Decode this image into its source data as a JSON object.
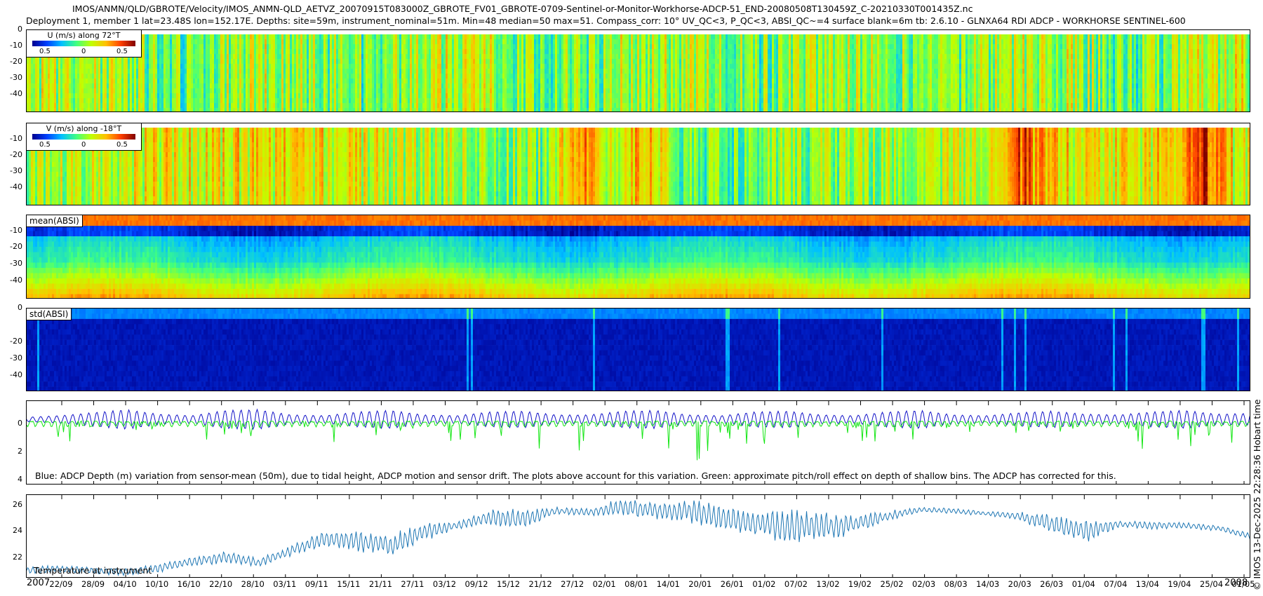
{
  "header": {
    "line1": "IMOS/ANMN/QLD/GBROTE/Velocity/IMOS_ANMN-QLD_AETVZ_20070915T083000Z_GBROTE_FV01_GBROTE-0709-Sentinel-or-Monitor-Workhorse-ADCP-51_END-20080508T130459Z_C-20210330T001435Z.nc",
    "line2": "Deployment 1, member 1 lat=23.48S lon=152.17E. Depths: site=59m, instrument_nominal=51m. Min=48 median=50 max=51. Compass_corr: 10° UV_QC<3, P_QC<3, ABSI_QC~=4 surface blank=6m tb: 2.6.10 - GLNXA64 RDI ADCP - WORKHORSE SENTINEL-600"
  },
  "right_label": "© IMOS 13-Dec-2025 22:28:36 Hobart time",
  "colors": {
    "blue_series": "#1414c8",
    "green_series": "#14e614",
    "temp_series": "#1f77b4",
    "jet": [
      "#00008f",
      "#0040ff",
      "#00c0ff",
      "#40ff80",
      "#c0ff00",
      "#ffc000",
      "#ff4000",
      "#800000"
    ]
  },
  "panels": {
    "u": {
      "colorbar_title": "U (m/s) along 72°T",
      "colorbar_ticks": [
        "0.5",
        "0",
        "0.5"
      ],
      "ylabels": [
        "0",
        "-10",
        "-20",
        "-30",
        "-40"
      ]
    },
    "v": {
      "colorbar_title": "V (m/s) along -18°T",
      "colorbar_ticks": [
        "0.5",
        "0",
        "0.5"
      ],
      "ylabels": [
        "0",
        "-10",
        "-20",
        "-30",
        "-40"
      ]
    },
    "mean": {
      "tag": "mean(ABSI)",
      "ylabels": [
        "0",
        "-10",
        "-20",
        "-30",
        "-40"
      ]
    },
    "std": {
      "tag": "std(ABSI)",
      "ylabels": [
        "0",
        "-10",
        "-20",
        "-30",
        "-40"
      ]
    },
    "depth": {
      "note": "Blue: ADCP Depth (m) variation from sensor-mean (50m), due to tidal height, ADCP motion and sensor drift. The plots above account for this variation. Green: approximate pitch/roll effect on depth of shallow bins. The ADCP has corrected for this.",
      "ylabels": [
        "0",
        "2",
        "4"
      ]
    },
    "temp": {
      "note": "Temperature at instrument",
      "ylabels": [
        "26",
        "24",
        "22"
      ]
    }
  },
  "chart_data": [
    {
      "type": "heatmap",
      "name": "U (m/s) along 72°T",
      "x_range": [
        "2007-09-15",
        "2008-05-08"
      ],
      "y_range_m": [
        -50,
        0
      ],
      "color_range": [
        -0.5,
        0.5
      ],
      "description": "Horizontal velocity component, mostly near 0 with alternating tidal bands"
    },
    {
      "type": "heatmap",
      "name": "V (m/s) along -18°T",
      "x_range": [
        "2007-09-15",
        "2008-05-08"
      ],
      "y_range_m": [
        -50,
        0
      ],
      "color_range": [
        -0.5,
        0.5
      ],
      "high_events": [
        {
          "date": "2007-12-31",
          "value": 0.5
        },
        {
          "date": "2008-01-12",
          "value": 0.4
        },
        {
          "date": "2008-03-24",
          "value": 0.3
        },
        {
          "date": "2008-04-28",
          "value": 0.45
        }
      ]
    },
    {
      "type": "heatmap",
      "name": "mean(ABSI)",
      "x_range": [
        "2007-09-15",
        "2008-05-08"
      ],
      "y_range_m": [
        -50,
        0
      ]
    },
    {
      "type": "heatmap",
      "name": "std(ABSI)",
      "x_range": [
        "2007-09-15",
        "2008-05-08"
      ],
      "y_range_m": [
        -50,
        0
      ]
    },
    {
      "type": "line",
      "name": "ADCP depth variation",
      "ylim": [
        4.2,
        -1.3
      ],
      "x_ticks": [
        "22/09",
        "28/09",
        "04/10",
        "10/10",
        "16/10",
        "22/10",
        "28/10",
        "03/11",
        "09/11",
        "15/11",
        "21/11",
        "27/11",
        "03/12",
        "09/12",
        "15/12",
        "21/12",
        "27/12",
        "02/01",
        "08/01",
        "14/01",
        "20/01",
        "26/01",
        "01/02",
        "07/02",
        "13/02",
        "19/02",
        "25/02",
        "02/03",
        "08/03",
        "14/03",
        "20/03",
        "26/03",
        "01/04",
        "07/04",
        "13/04",
        "19/04",
        "25/04",
        "01/05"
      ],
      "blue_amplitude_m": [
        0.3,
        0.5,
        0.9,
        1.3,
        0.7,
        0.5,
        1.2,
        1.3,
        0.6,
        0.5,
        1.0,
        1.2,
        0.6,
        0.5,
        1.0,
        1.1,
        0.6,
        0.6,
        1.1,
        1.2,
        0.6,
        0.5,
        1.0,
        1.1,
        0.6,
        0.5,
        1.0,
        1.2,
        0.6,
        0.5,
        0.9,
        1.1,
        0.7,
        0.6,
        1.0,
        1.2,
        0.7,
        0.8
      ],
      "green_min_m": [
        0.5,
        0.9,
        2.3,
        1.0,
        0.6,
        1.5,
        1.9,
        0.7,
        0.6,
        1.3,
        1.6,
        0.8,
        0.7,
        1.4,
        1.5,
        0.8,
        3.2,
        2.6,
        1.4,
        2.3,
        3.4,
        1.2,
        1.9,
        2.4,
        1.8,
        1.0,
        2.3,
        1.2,
        1.6,
        2.0,
        2.7,
        1.7,
        1.9,
        2.1,
        1.5,
        1.6,
        1.9,
        4.0
      ]
    },
    {
      "type": "line",
      "name": "Temperature at instrument",
      "ylim": [
        20.7,
        27.0
      ],
      "x_ticks": [
        "22/09",
        "28/09",
        "04/10",
        "10/10",
        "16/10",
        "22/10",
        "28/10",
        "03/11",
        "09/11",
        "15/11",
        "21/11",
        "27/11",
        "03/12",
        "09/12",
        "15/12",
        "21/12",
        "27/12",
        "02/01",
        "08/01",
        "14/01",
        "20/01",
        "26/01",
        "01/02",
        "07/02",
        "13/02",
        "19/02",
        "25/02",
        "02/03",
        "08/03",
        "14/03",
        "20/03",
        "26/03",
        "01/04",
        "07/04",
        "13/04",
        "19/04",
        "25/04",
        "01/05"
      ],
      "year_labels": [
        "2007",
        "2008"
      ],
      "weekly_mean": [
        21.3,
        21.4,
        21.3,
        21.2,
        21.5,
        22.0,
        22.3,
        21.9,
        22.8,
        23.7,
        23.5,
        23.2,
        24.2,
        24.7,
        25.3,
        25.2,
        25.8,
        25.7,
        26.1,
        25.8,
        25.8,
        25.3,
        24.9,
        24.6,
        24.6,
        24.8,
        25.4,
        25.9,
        25.8,
        25.6,
        25.4,
        24.8,
        24.3,
        24.8,
        24.7,
        24.7,
        24.5,
        23.9
      ],
      "weekly_range": [
        0.6,
        0.5,
        0.5,
        0.5,
        0.6,
        0.6,
        0.9,
        0.6,
        0.7,
        1.0,
        1.4,
        1.5,
        1.3,
        0.5,
        1.1,
        1.4,
        0.5,
        0.5,
        1.2,
        1.1,
        1.5,
        2.0,
        1.5,
        2.3,
        2.2,
        1.2,
        0.8,
        0.3,
        0.4,
        0.3,
        0.6,
        1.3,
        1.6,
        0.4,
        0.5,
        0.4,
        0.4,
        0.4
      ]
    }
  ]
}
